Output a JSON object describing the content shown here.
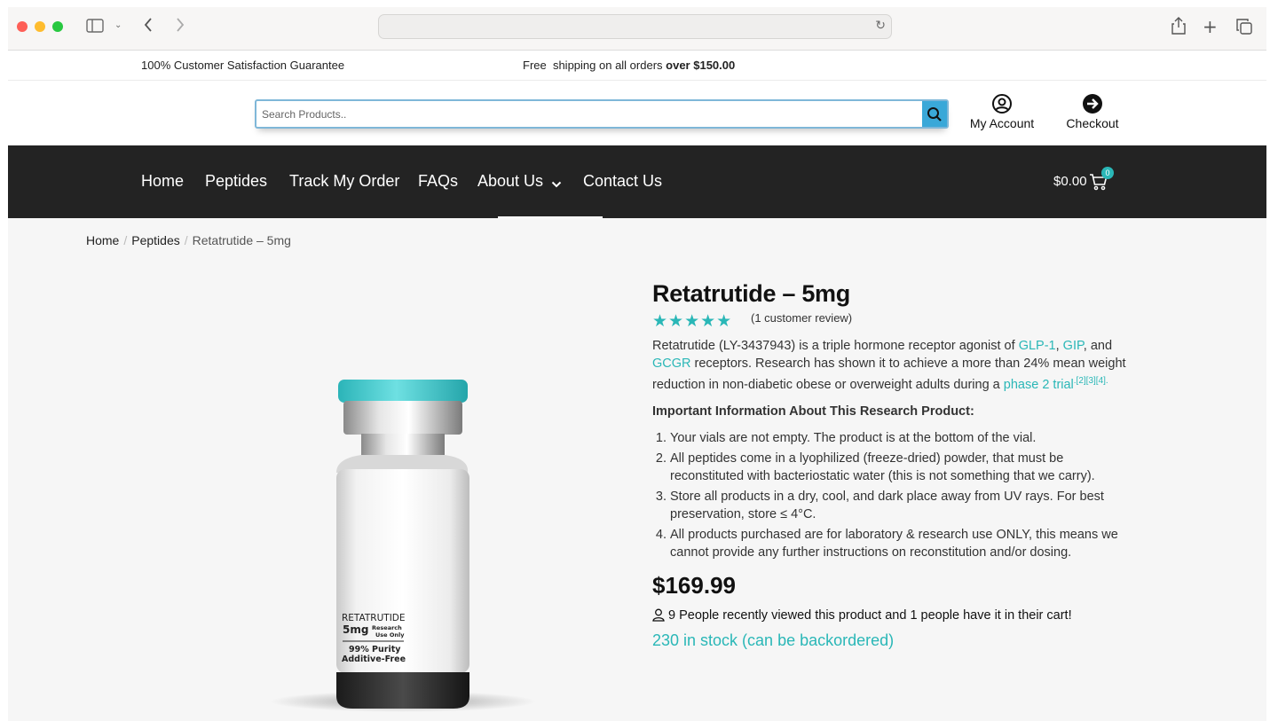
{
  "topbar": {
    "guarantee": "100% Customer Satisfaction Guarantee",
    "shipping_prefix": "Free  shipping on all orders ",
    "shipping_bold": "over $150.00"
  },
  "search": {
    "placeholder": "Search Products.."
  },
  "header": {
    "account_label": "My Account",
    "checkout_label": "Checkout"
  },
  "nav": {
    "items": [
      "Home",
      "Peptides",
      "Track My Order",
      "FAQs",
      "About Us",
      "Contact Us"
    ],
    "cart_total": "$0.00",
    "cart_count": "0"
  },
  "breadcrumb": {
    "home": "Home",
    "category": "Peptides",
    "current": "Retatrutide – 5mg"
  },
  "product": {
    "title": "Retatrutide – 5mg",
    "rating": 5,
    "reviews": "(1 customer review)",
    "desc_1": "Retatrutide (LY-3437943) is a triple hormone receptor agonist of ",
    "link_glp": "GLP-1",
    "desc_2": ", ",
    "link_gip": "GIP",
    "desc_3": ", and ",
    "link_gcgr": "GCGR",
    "desc_4": " receptors. Research has shown it to achieve a more than 24% mean weight reduction in non-diabetic obese or overweight adults during a ",
    "link_phase": "phase 2 trial",
    "refs": ".[2][3][4].",
    "important_heading": "Important Information About This Research Product:",
    "notes": [
      "Your vials are not empty. The product is at the bottom of the vial.",
      "All peptides come in a lyophilized (freeze-dried) powder, that must be reconstituted with bacteriostatic water (this is not something that we carry).",
      "Store all products in a dry, cool, and dark place away from UV rays. For best preservation, store ≤ 4°C.",
      "All products purchased are for laboratory & research use ONLY, this means we cannot provide any further instructions on reconstitution and/or dosing."
    ],
    "price": "$169.99",
    "viewed": "9 People recently viewed this product and 1 people have it in their cart!",
    "stock": "230 in stock (can be backordered)"
  },
  "vial_label": {
    "name": "RETATRUTIDE",
    "dose": "5mg",
    "research": "Research",
    "use_only": "Use Only",
    "purity": "99% Purity",
    "additive": "Additive-Free"
  },
  "colors": {
    "accent": "#2ab7b7",
    "nav_bg": "#232323",
    "search_button": "#3aa8d8"
  }
}
